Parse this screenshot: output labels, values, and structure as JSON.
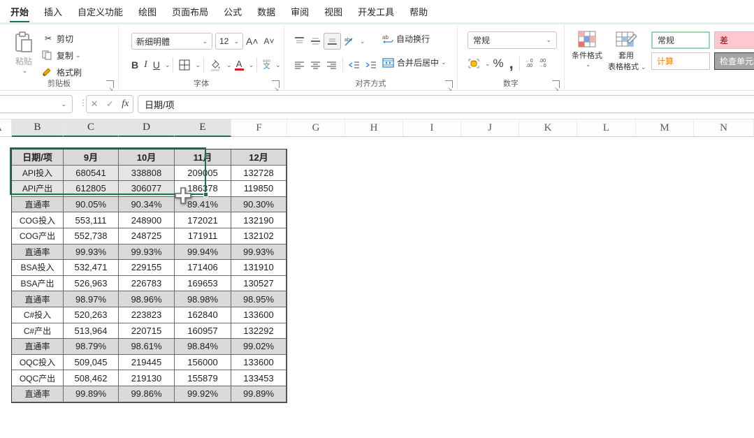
{
  "menu": {
    "tabs": [
      {
        "label": "开始",
        "active": true
      },
      {
        "label": "插入",
        "active": false
      },
      {
        "label": "自定义功能",
        "active": false
      },
      {
        "label": "绘图",
        "active": false
      },
      {
        "label": "页面布局",
        "active": false
      },
      {
        "label": "公式",
        "active": false
      },
      {
        "label": "数据",
        "active": false
      },
      {
        "label": "审阅",
        "active": false
      },
      {
        "label": "视图",
        "active": false
      },
      {
        "label": "开发工具",
        "active": false
      },
      {
        "label": "帮助",
        "active": false
      }
    ]
  },
  "ribbon": {
    "clipboard": {
      "title": "剪贴板",
      "paste": "粘贴",
      "cut": "剪切",
      "copy": "复制",
      "format_painter": "格式刷"
    },
    "font": {
      "title": "字体",
      "font_name": "新细明體",
      "font_size": "12",
      "bold": "B",
      "italic": "I",
      "underline": "U",
      "phonetic": "文"
    },
    "alignment": {
      "title": "对齐方式",
      "wrap_text": "自动换行",
      "merge_center": "合并后居中"
    },
    "number": {
      "title": "数字",
      "format_selected": "常规",
      "percent": "%",
      "comma": ","
    },
    "styles": {
      "conditional_format": "条件格式",
      "format_as_table_line1": "套用",
      "format_as_table_line2": "表格格式",
      "gallery": [
        {
          "label": "常规",
          "kind": "normal"
        },
        {
          "label": "差",
          "kind": "bad"
        },
        {
          "label": "计算",
          "kind": "calc"
        },
        {
          "label": "检查单元格",
          "kind": "check"
        }
      ]
    }
  },
  "formula_bar": {
    "name_box_value": "",
    "fx_label": "fx",
    "cancel_icon": "✕",
    "enter_icon": "✓",
    "value": "日期/项"
  },
  "column_headers": {
    "letters": [
      "A",
      "B",
      "C",
      "D",
      "E",
      "F",
      "G",
      "H",
      "I",
      "J",
      "K",
      "L",
      "M",
      "N"
    ],
    "selected": [
      "B",
      "C",
      "D",
      "E"
    ]
  },
  "sheet": {
    "rows": [
      {
        "type": "header",
        "cells": [
          "日期/项",
          "9月",
          "10月",
          "11月",
          "12月"
        ]
      },
      {
        "type": "sel",
        "cells": [
          "API投入",
          "680541",
          "338808",
          "209005",
          "132728"
        ]
      },
      {
        "type": "sel",
        "cells": [
          "API产出",
          "612805",
          "306077",
          "186378",
          "119850"
        ]
      },
      {
        "type": "gray",
        "cells": [
          "直通率",
          "90.05%",
          "90.34%",
          "89.41%",
          "90.30%"
        ]
      },
      {
        "type": "norm",
        "cells": [
          "COG投入",
          "553,111",
          "248900",
          "172021",
          "132190"
        ]
      },
      {
        "type": "norm",
        "cells": [
          "COG产出",
          "552,738",
          "248725",
          "171911",
          "132102"
        ]
      },
      {
        "type": "gray",
        "cells": [
          "直通率",
          "99.93%",
          "99.93%",
          "99.94%",
          "99.93%"
        ]
      },
      {
        "type": "norm",
        "cells": [
          "BSA投入",
          "532,471",
          "229155",
          "171406",
          "131910"
        ]
      },
      {
        "type": "norm",
        "cells": [
          "BSA产出",
          "526,963",
          "226783",
          "169653",
          "130527"
        ]
      },
      {
        "type": "gray",
        "cells": [
          "直通率",
          "98.97%",
          "98.96%",
          "98.98%",
          "98.95%"
        ]
      },
      {
        "type": "norm",
        "cells": [
          "C#投入",
          "520,263",
          "223823",
          "162840",
          "133600"
        ]
      },
      {
        "type": "norm",
        "cells": [
          "C#产出",
          "513,964",
          "220715",
          "160957",
          "132292"
        ]
      },
      {
        "type": "gray",
        "cells": [
          "直通率",
          "98.79%",
          "98.61%",
          "98.84%",
          "99.02%"
        ]
      },
      {
        "type": "norm",
        "cells": [
          "OQC投入",
          "509,045",
          "219445",
          "156000",
          "133600"
        ]
      },
      {
        "type": "norm",
        "cells": [
          "OQC产出",
          "508,462",
          "219130",
          "155879",
          "133453"
        ]
      },
      {
        "type": "gray",
        "cells": [
          "直通率",
          "99.89%",
          "99.86%",
          "99.92%",
          "99.89%"
        ]
      }
    ]
  },
  "colors": {
    "accent_green": "#217346",
    "header_fill": "#d9d9d9",
    "selection_tint": "#e4e6e3",
    "style_bad_bg": "#ffc7ce",
    "style_bad_text": "#9c0006",
    "style_calc_text": "#fa7d00",
    "style_check_bg": "#a5a5a5"
  }
}
